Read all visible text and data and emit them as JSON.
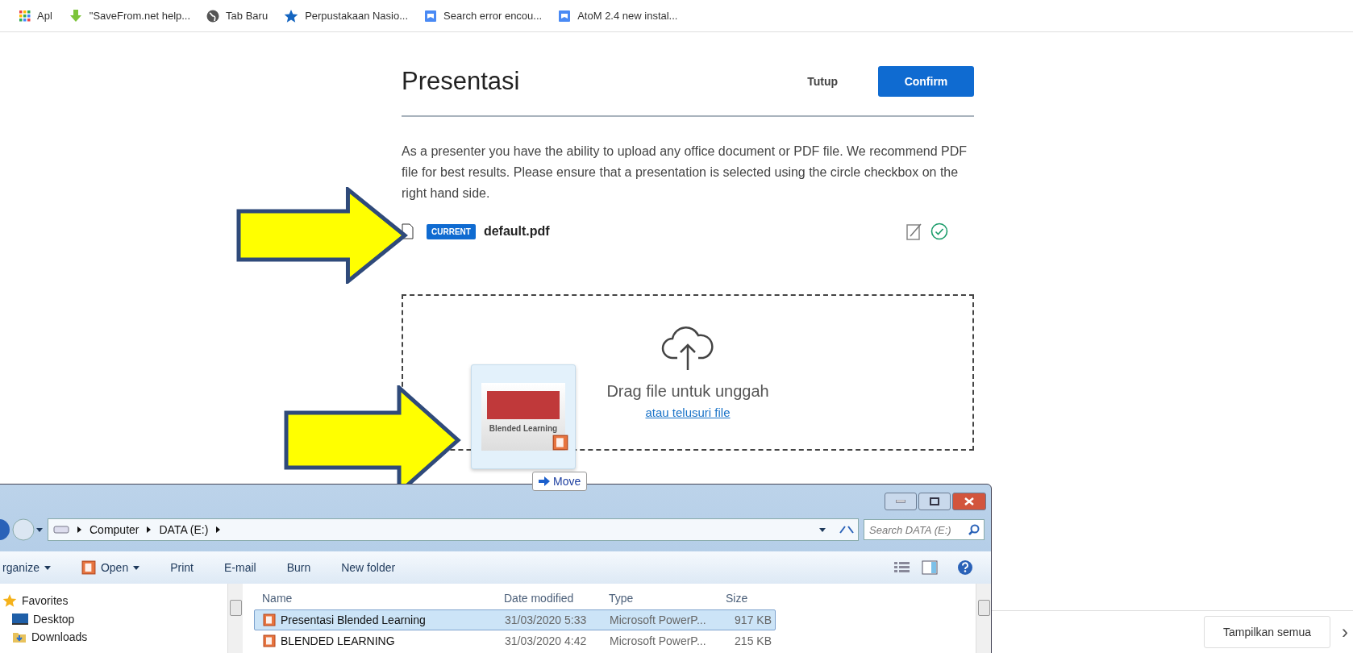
{
  "bookmarks": [
    {
      "kind": "apps",
      "label": "Apl"
    },
    {
      "kind": "download",
      "label": "\"SaveFrom.net help..."
    },
    {
      "kind": "globe",
      "label": "Tab Baru"
    },
    {
      "kind": "star",
      "label": "Perpustakaan Nasio..."
    },
    {
      "kind": "doc",
      "label": "Search error encou..."
    },
    {
      "kind": "doc",
      "label": "AtoM 2.4 new instal..."
    }
  ],
  "dialog": {
    "title": "Presentasi",
    "close_label": "Tutup",
    "confirm_label": "Confirm",
    "description": "As a presenter you have the ability to upload any office document or PDF file. We recommend PDF file for best results. Please ensure that a presentation is selected using the circle checkbox on the right hand side.",
    "files": [
      {
        "badge": "CURRENT",
        "name": "default.pdf",
        "selected": true
      }
    ],
    "dropzone": {
      "prompt": "Drag file untuk unggah",
      "link": "atau telusuri file"
    }
  },
  "drag_preview": {
    "slide_title": "Blended Learning",
    "action": "Move"
  },
  "explorer": {
    "breadcrumb": [
      "Computer",
      "DATA (E:)"
    ],
    "search": {
      "placeholder": "Search DATA (E:)"
    },
    "toolbar": [
      {
        "label": "rganize",
        "kind": "menu"
      },
      {
        "label": "Open",
        "kind": "open"
      },
      {
        "label": "Print",
        "kind": "plain"
      },
      {
        "label": "E-mail",
        "kind": "plain"
      },
      {
        "label": "Burn",
        "kind": "plain"
      },
      {
        "label": "New folder",
        "kind": "plain"
      }
    ],
    "nav": [
      {
        "label": "Favorites",
        "kind": "star"
      },
      {
        "label": "Desktop",
        "kind": "desktop"
      },
      {
        "label": "Downloads",
        "kind": "folder"
      }
    ],
    "columns": [
      "Name",
      "Date modified",
      "Type",
      "Size"
    ],
    "rows": [
      {
        "name": "Presentasi Blended Learning",
        "date": "31/03/2020 5:33",
        "type": "Microsoft PowerP...",
        "size": "917 KB",
        "selected": true
      },
      {
        "name": "BLENDED LEARNING",
        "date": "31/03/2020 4:42",
        "type": "Microsoft PowerP...",
        "size": "215 KB",
        "selected": false
      }
    ]
  },
  "download_bar": {
    "button": "Tampilkan semua",
    "arrow": "›"
  }
}
